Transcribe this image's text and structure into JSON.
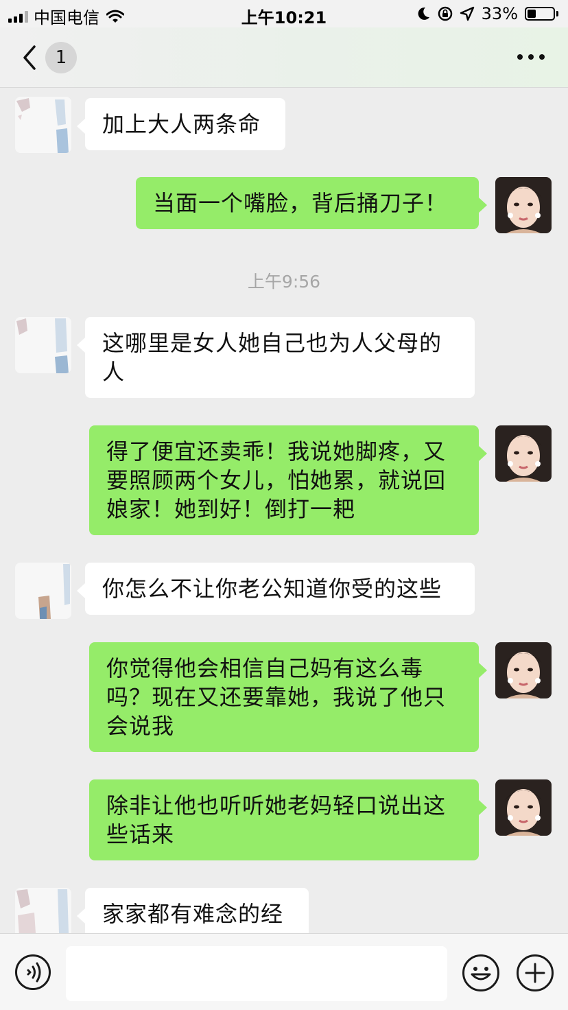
{
  "status_bar": {
    "carrier": "中国电信",
    "time": "上午10:21",
    "battery_percent": "33%",
    "battery_level": 0.33,
    "icons": [
      "signal-icon",
      "wifi-icon",
      "moon-icon",
      "orientation-lock-icon",
      "location-icon",
      "battery-icon"
    ]
  },
  "nav": {
    "unread_count": "1",
    "icons": [
      "back-chevron-icon",
      "more-dots-icon"
    ]
  },
  "messages": [
    {
      "sender": "other",
      "text": "加上大人两条命"
    },
    {
      "sender": "me",
      "text": "当面一个嘴脸，背后捅刀子！"
    },
    {
      "type": "time",
      "text": "上午9:56"
    },
    {
      "sender": "other",
      "text": "这哪里是女人她自己也为人父母的人"
    },
    {
      "sender": "me",
      "text": "得了便宜还卖乖！我说她脚疼，又要照顾两个女儿，怕她累，就说回娘家！她到好！倒打一耙"
    },
    {
      "sender": "other",
      "text": "你怎么不让你老公知道你受的这些"
    },
    {
      "sender": "me",
      "text": "你觉得他会相信自己妈有这么毒吗？现在又还要靠她，我说了他只会说我"
    },
    {
      "sender": "me",
      "text": "除非让他也听听她老妈轻口说出这些话来"
    },
    {
      "sender": "other",
      "text": "家家都有难念的经"
    }
  ],
  "input_bar": {
    "placeholder": "",
    "icons": [
      "voice-icon",
      "emoji-icon",
      "plus-icon"
    ]
  },
  "colors": {
    "background": "#ededed",
    "outgoing_bubble": "#95ec69",
    "incoming_bubble": "#ffffff",
    "timestamp_text": "#a6a6a6"
  }
}
